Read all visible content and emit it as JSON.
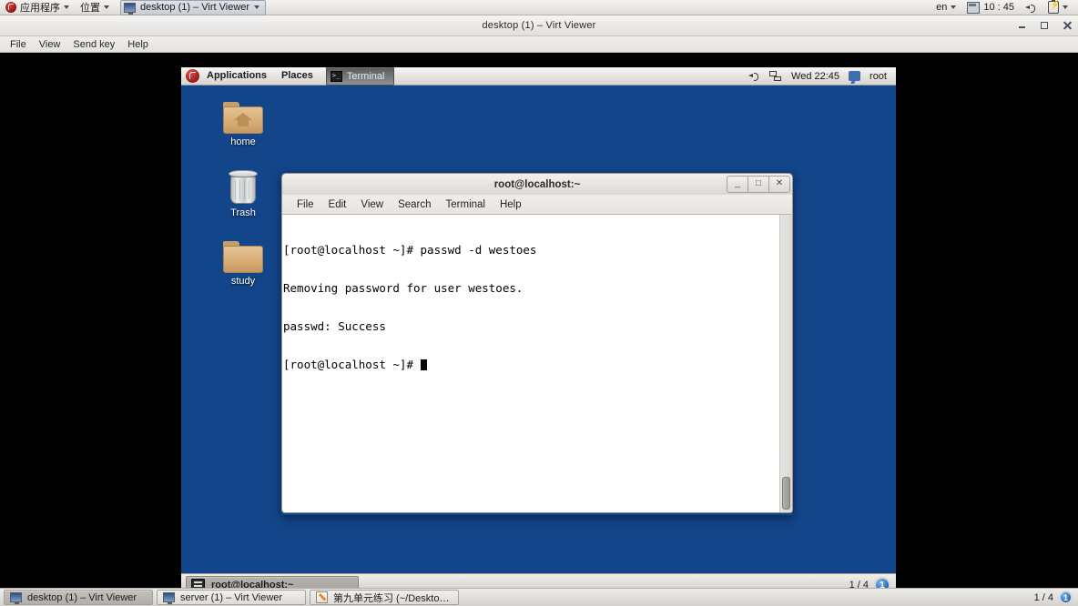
{
  "host_top_panel": {
    "applications_label": "应用程序",
    "places_label": "位置",
    "window_task_label": "desktop (1) – Virt Viewer",
    "keyboard_layout": "en",
    "clock": "10 : 45",
    "icons": {
      "fedora": "fedora-logo-icon",
      "arrow": "chevron-down-icon",
      "calendar": "calendar-icon",
      "volume": "volume-icon",
      "battery": "battery-charging-icon"
    }
  },
  "virt_viewer": {
    "title": "desktop (1) – Virt Viewer",
    "menu": [
      {
        "label": "File"
      },
      {
        "label": "View"
      },
      {
        "label": "Send key"
      },
      {
        "label": "Help"
      }
    ],
    "window_controls": {
      "minimize": "minimize-icon",
      "maximize": "maximize-icon",
      "close": "close-icon"
    }
  },
  "guest": {
    "panel": {
      "applications_label": "Applications",
      "places_label": "Places",
      "task_label": "Terminal",
      "clock": "Wed 22:45",
      "user": "root"
    },
    "desktop_icons": [
      {
        "label": "home",
        "icon": "home-folder-icon"
      },
      {
        "label": "Trash",
        "icon": "trash-icon"
      },
      {
        "label": "study",
        "icon": "folder-icon"
      }
    ],
    "terminal": {
      "title": "root@localhost:~",
      "menu": [
        {
          "label": "File"
        },
        {
          "label": "Edit"
        },
        {
          "label": "View"
        },
        {
          "label": "Search"
        },
        {
          "label": "Terminal"
        },
        {
          "label": "Help"
        }
      ],
      "window_controls": {
        "minimize": "_",
        "maximize": "□",
        "close": "✕"
      },
      "lines": [
        "[root@localhost ~]# passwd -d westoes",
        "Removing password for user westoes.",
        "passwd: Success"
      ],
      "prompt": "[root@localhost ~]# "
    },
    "bottom_panel": {
      "task_label": "root@localhost:~",
      "workspace_indicator": "1 / 4",
      "workspace_current": "1"
    }
  },
  "host_taskbar": {
    "buttons": [
      {
        "label": "desktop (1) – Virt Viewer",
        "icon": "monitor-icon",
        "active": true
      },
      {
        "label": "server (1) – Virt Viewer",
        "icon": "monitor-icon",
        "active": false
      },
      {
        "label": "第九单元练习 (~/Desktop/新建文...",
        "icon": "gedit-icon",
        "active": false
      }
    ],
    "workspace_indicator": "1 / 4",
    "workspace_current": "1"
  },
  "colors": {
    "desktop_blue": "#13458a",
    "panel_grey": "#e2dfdb",
    "accent_blue": "#1f66b5"
  }
}
